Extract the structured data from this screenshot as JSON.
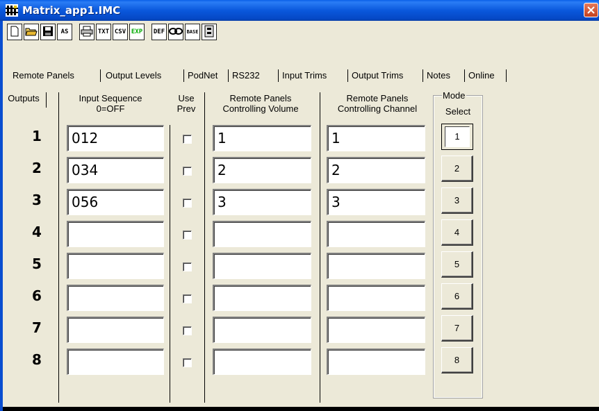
{
  "window": {
    "title": "Matrix_app1.IMC"
  },
  "toolbar": {
    "buttons": [
      {
        "name": "new-file-icon",
        "label": ""
      },
      {
        "name": "open-folder-icon",
        "label": ""
      },
      {
        "name": "save-disk-icon",
        "label": ""
      },
      {
        "name": "save-as-icon",
        "label": "AS"
      },
      {
        "name": "print-icon",
        "label": ""
      },
      {
        "name": "export-txt-icon",
        "label": "TXT"
      },
      {
        "name": "export-csv-icon",
        "label": "CSV"
      },
      {
        "name": "export-exp-icon",
        "label": "EXP"
      },
      {
        "name": "default-def-icon",
        "label": "DEF"
      },
      {
        "name": "link-icon",
        "label": ""
      },
      {
        "name": "base-icon",
        "label": "BASE"
      },
      {
        "name": "device-icon",
        "label": ""
      }
    ]
  },
  "tabs": [
    "Remote Panels",
    "Output Levels",
    "PodNet",
    "RS232",
    "Input Trims",
    "Output Trims",
    "Notes",
    "Online"
  ],
  "headers": {
    "outputs": "Outputs",
    "input_sequence_1": "Input Sequence",
    "input_sequence_2": "0=OFF",
    "use_prev_1": "Use",
    "use_prev_2": "Prev",
    "vol_1": "Remote Panels",
    "vol_2": "Controlling Volume",
    "chan_1": "Remote Panels",
    "chan_2": "Controlling Channel",
    "mode_1": "Mode",
    "mode_2": "Select"
  },
  "rows": [
    {
      "num": "1",
      "seq": "012",
      "vol": "1",
      "chan": "1"
    },
    {
      "num": "2",
      "seq": "034",
      "vol": "2",
      "chan": "2"
    },
    {
      "num": "3",
      "seq": "056",
      "vol": "3",
      "chan": "3"
    },
    {
      "num": "4",
      "seq": "",
      "vol": "",
      "chan": ""
    },
    {
      "num": "5",
      "seq": "",
      "vol": "",
      "chan": ""
    },
    {
      "num": "6",
      "seq": "",
      "vol": "",
      "chan": ""
    },
    {
      "num": "7",
      "seq": "",
      "vol": "",
      "chan": ""
    },
    {
      "num": "8",
      "seq": "",
      "vol": "",
      "chan": ""
    }
  ],
  "mode_buttons": [
    "1",
    "2",
    "3",
    "4",
    "5",
    "6",
    "7",
    "8"
  ],
  "mode_selected": "1",
  "colors": {
    "titlebar": "#0A58DC",
    "close": "#C2401E",
    "face": "#ECE9D8"
  }
}
